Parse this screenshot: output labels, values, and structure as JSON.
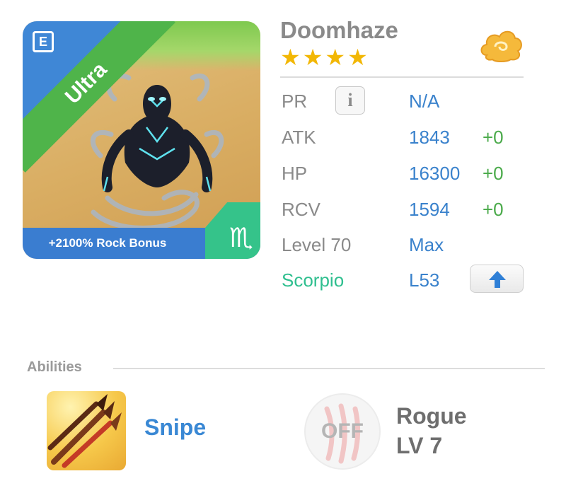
{
  "monster": {
    "rarity": "Ultra",
    "bonus": "+2100% Rock Bonus",
    "zodiac_icon": "scorpio-glyph",
    "name": "Doomhaze",
    "stars": 4
  },
  "stats": {
    "pr": {
      "label": "PR",
      "value": "N/A"
    },
    "atk": {
      "label": "ATK",
      "value": "1843",
      "bonus": "+0"
    },
    "hp": {
      "label": "HP",
      "value": "16300",
      "bonus": "+0"
    },
    "rcv": {
      "label": "RCV",
      "value": "1594",
      "bonus": "+0"
    },
    "level": {
      "label": "Level 70",
      "value": "Max"
    },
    "sign": {
      "label": "Scorpio",
      "value": "L53"
    }
  },
  "abilities": {
    "title": "Abilities",
    "items": [
      {
        "name": "Snipe",
        "icon": "arrows-icon"
      },
      {
        "name": "Rogue",
        "level": "LV 7",
        "status": "OFF",
        "icon": "claw-icon"
      }
    ]
  },
  "colors": {
    "accent_blue": "#3a82cc",
    "bonus_green": "#4aaa4a",
    "zodiac_green": "#2fbf8f",
    "star_gold": "#f2b705"
  }
}
